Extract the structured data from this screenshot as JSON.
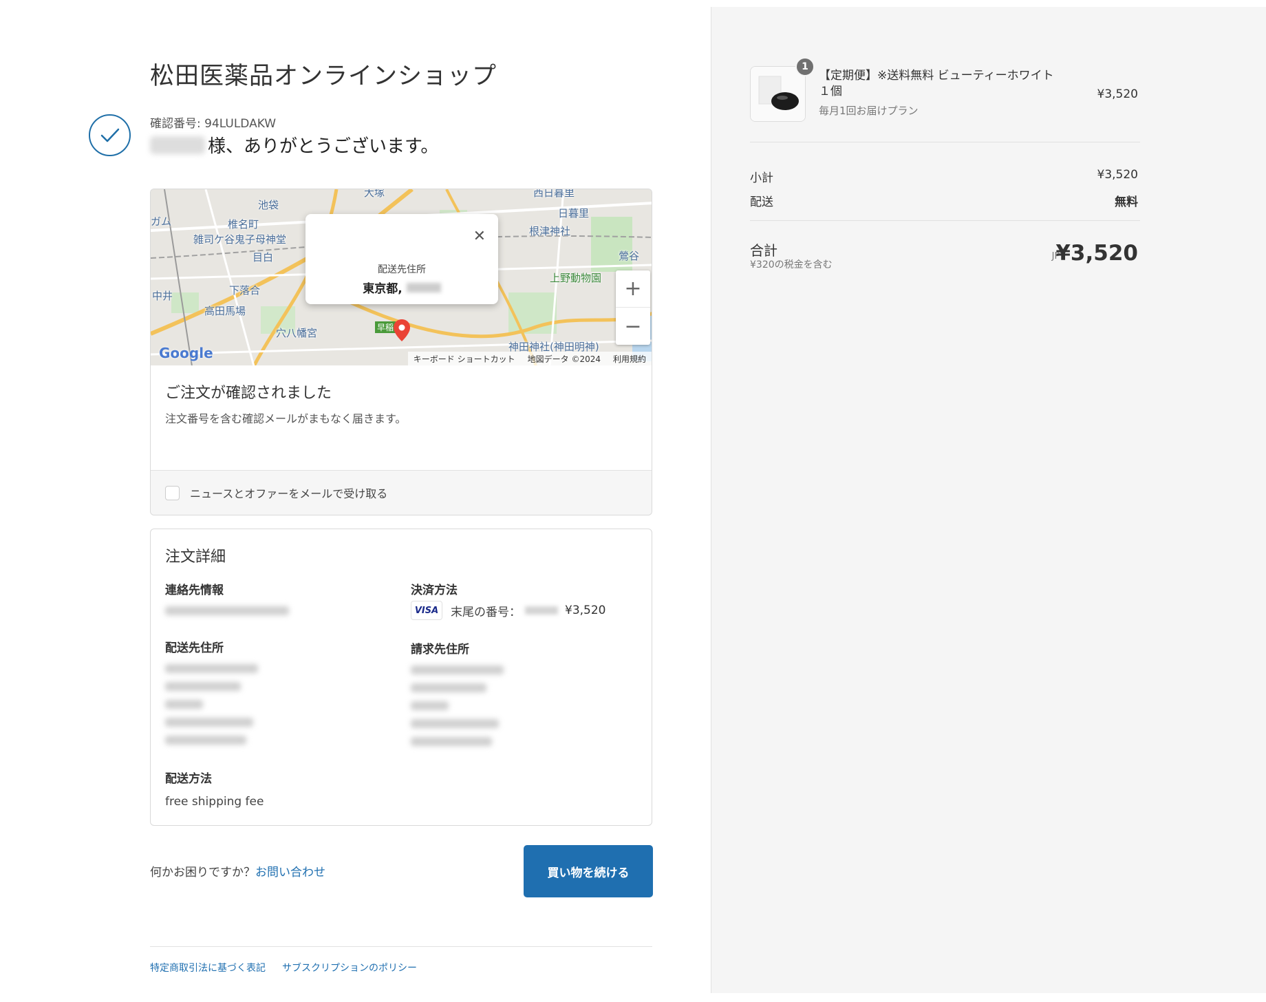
{
  "header": {
    "shop_title": "松田医薬品オンラインショップ",
    "confirmation_number": "確認番号: 94LULDAKW",
    "thanks_text": "様、ありがとうございます。"
  },
  "map": {
    "popup_label": "配送先住所",
    "popup_value": "東京都,",
    "zoom_in": "+",
    "zoom_out": "−",
    "attribution": {
      "logo": "Google",
      "shortcuts": "キーボード ショートカット",
      "map_data": "地図データ ©2024",
      "terms": "利用規約"
    },
    "labels": [
      {
        "text": "池袋",
        "kind": "place"
      },
      {
        "text": "大塚",
        "kind": "place"
      },
      {
        "text": "西日暮里",
        "kind": "place"
      },
      {
        "text": "日暮里",
        "kind": "place"
      },
      {
        "text": "椎名町",
        "kind": "place"
      },
      {
        "text": "雑司ケ谷鬼子母神堂",
        "kind": "place"
      },
      {
        "text": "根津神社",
        "kind": "place"
      },
      {
        "text": "目白",
        "kind": "place"
      },
      {
        "text": "鶯谷",
        "kind": "place"
      },
      {
        "text": "下落合",
        "kind": "place"
      },
      {
        "text": "上野動物園",
        "kind": "park"
      },
      {
        "text": "中井",
        "kind": "place"
      },
      {
        "text": "高田馬場",
        "kind": "place"
      },
      {
        "text": "穴八幡宮",
        "kind": "place"
      },
      {
        "text": "早稲",
        "kind": "park"
      },
      {
        "text": "神田神社(神田明神)",
        "kind": "place"
      },
      {
        "text": "ガム",
        "kind": "place"
      }
    ]
  },
  "confirmation": {
    "title": "ご注文が確認されました",
    "description": "注文番号を含む確認メールがまもなく届きます。",
    "newsletter_label": "ニュースとオファーをメールで受け取る"
  },
  "details": {
    "title": "注文詳細",
    "contact_heading": "連絡先情報",
    "payment_heading": "決済方法",
    "card_brand": "VISA",
    "card_text": "末尾の番号：",
    "payment_amount": "¥3,520",
    "shipping_address_heading": "配送先住所",
    "billing_address_heading": "請求先住所",
    "shipping_method_heading": "配送方法",
    "shipping_method": "free shipping fee"
  },
  "footer": {
    "help_text": "何かお困りですか？",
    "help_link": "お問い合わせ",
    "continue_button": "買い物を続ける",
    "link_legal": "特定商取引法に基づく表記",
    "link_subscription": "サブスクリプションのポリシー"
  },
  "summary": {
    "quantity_badge": "1",
    "product_name": "【定期便】※送料無料 ビューティーホワイト　１個",
    "product_plan": "毎月1回お届けプラン",
    "product_price": "¥3,520",
    "subtotal_label": "小計",
    "subtotal_value": "¥3,520",
    "shipping_label": "配送",
    "shipping_value": "無料",
    "total_label": "合計",
    "tax_note": "¥320の税金を含む",
    "currency": "JPY",
    "total_value": "¥3,520"
  },
  "colors": {
    "accent": "#1f6fb0",
    "summary_bg": "#f5f5f5",
    "border": "#d9d9d9"
  }
}
